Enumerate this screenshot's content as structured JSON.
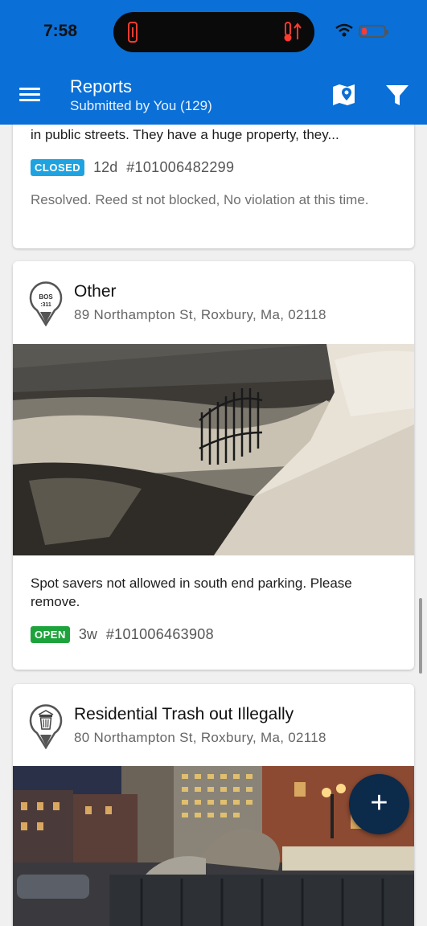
{
  "status_bar": {
    "time": "7:58"
  },
  "header": {
    "title": "Reports",
    "subtitle": "Submitted by You (129)",
    "menu_icon": "hamburger-icon",
    "map_icon": "map-pin-icon",
    "filter_icon": "filter-icon"
  },
  "reports": [
    {
      "description": "in public streets. They have a huge property, they...",
      "status": "CLOSED",
      "age": "12d",
      "ticket": "#101006482299",
      "resolution": "Resolved. Reed st not blocked, No violation at this time."
    },
    {
      "category": "Other",
      "category_icon": "bos-311-icon",
      "category_icon_text": "BOS :311",
      "address": "89 Northampton St, Roxbury, Ma, 02118",
      "description": "Spot savers not allowed in south end parking. Please remove.",
      "status": "OPEN",
      "age": "3w",
      "ticket": "#101006463908"
    },
    {
      "category": "Residential Trash out Illegally",
      "category_icon": "trash-can-icon",
      "address": "80 Northampton St, Roxbury, Ma, 02118"
    }
  ],
  "fab": {
    "label": "+"
  },
  "colors": {
    "header": "#0a6fd6",
    "closed_badge": "#1ea3e0",
    "open_badge": "#1ea33c",
    "fab": "#0c2a4a"
  }
}
